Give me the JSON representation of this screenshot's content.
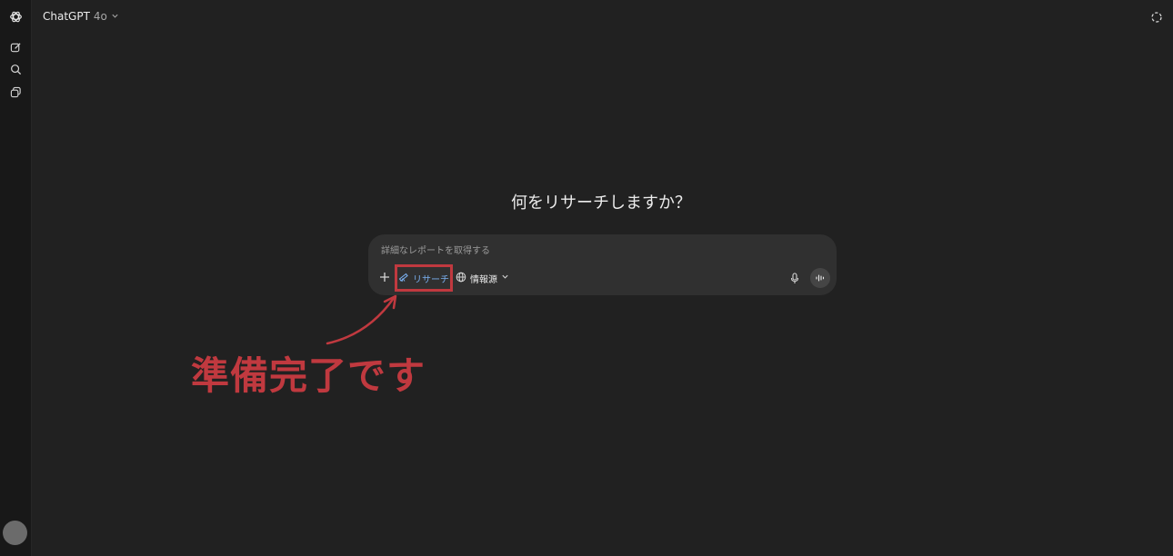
{
  "topbar": {
    "model_name": "ChatGPT",
    "model_version": "4o"
  },
  "sidebar": {
    "icons": [
      "openai-logo-icon",
      "new-chat-icon",
      "search-icon",
      "library-icon"
    ]
  },
  "main": {
    "heading": "何をリサーチしますか？"
  },
  "composer": {
    "placeholder": "詳細なレポートを取得する",
    "research_label": "リサーチ",
    "sources_label": "情報源"
  },
  "annotation": {
    "text": "準備完了です",
    "color": "#c0393f"
  },
  "colors": {
    "background": "#212121",
    "sidebar": "#181818",
    "composer": "#303030",
    "research_accent": "#7ab0f0"
  }
}
